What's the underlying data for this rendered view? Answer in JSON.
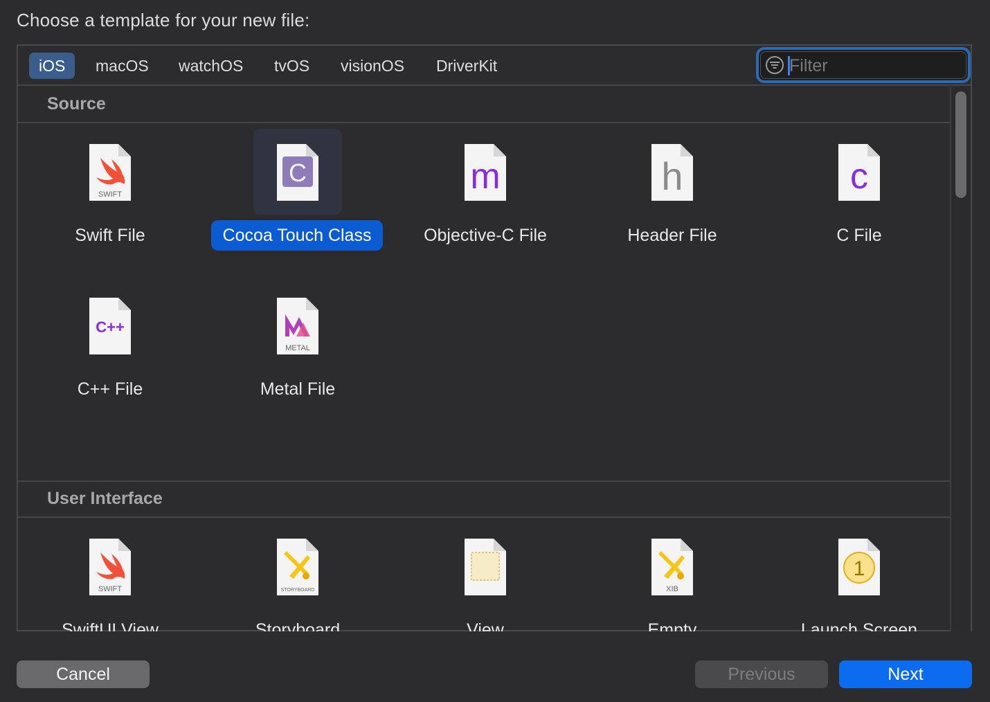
{
  "title": "Choose a template for your new file:",
  "tabs": [
    {
      "label": "iOS",
      "active": true
    },
    {
      "label": "macOS",
      "active": false
    },
    {
      "label": "watchOS",
      "active": false
    },
    {
      "label": "tvOS",
      "active": false
    },
    {
      "label": "visionOS",
      "active": false
    },
    {
      "label": "DriverKit",
      "active": false
    }
  ],
  "filter": {
    "placeholder": "Filter",
    "value": ""
  },
  "sections": [
    {
      "heading": "Source",
      "items": [
        {
          "label": "Swift File",
          "icon": "swift-file-icon",
          "badge": "SWIFT"
        },
        {
          "label": "Cocoa Touch Class",
          "icon": "cocoa-touch-class-icon",
          "glyph": "C",
          "selected": true
        },
        {
          "label": "Objective-C File",
          "icon": "objective-c-file-icon",
          "glyph": "m"
        },
        {
          "label": "Header File",
          "icon": "header-file-icon",
          "glyph": "h"
        },
        {
          "label": "C File",
          "icon": "c-file-icon",
          "glyph": "c"
        },
        {
          "label": "C++ File",
          "icon": "cpp-file-icon",
          "glyph": "C++"
        },
        {
          "label": "Metal File",
          "icon": "metal-file-icon",
          "badge": "METAL"
        }
      ]
    },
    {
      "heading": "User Interface",
      "items": [
        {
          "label": "SwiftUI View",
          "icon": "swiftui-view-icon",
          "badge": "SWIFT"
        },
        {
          "label": "Storyboard",
          "icon": "storyboard-icon",
          "badge": "STORYBOARD"
        },
        {
          "label": "View",
          "icon": "view-file-icon"
        },
        {
          "label": "Empty",
          "icon": "xib-file-icon",
          "badge": "XIB"
        },
        {
          "label": "Launch Screen",
          "icon": "launch-screen-icon",
          "glyph": "1"
        }
      ]
    }
  ],
  "buttons": {
    "cancel": "Cancel",
    "previous": "Previous",
    "next": "Next"
  },
  "colors": {
    "accent": "#0b6cf0",
    "selection": "#0b5bd3",
    "tab_active": "#3a5d8c",
    "swift": "#f05138",
    "purple": "#8a2be2",
    "ui_yellow": "#f5c518"
  }
}
